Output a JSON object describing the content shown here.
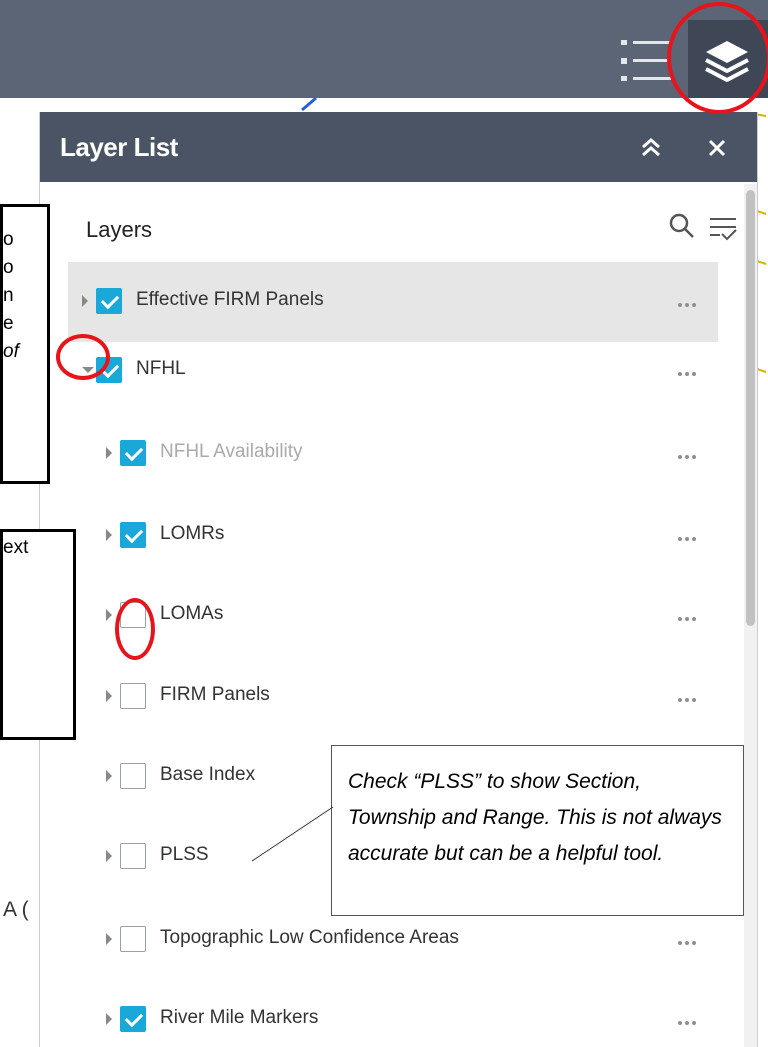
{
  "colors": {
    "topbar": "#5b6575",
    "panel_header": "#4a5465",
    "checkbox_checked": "#19a8d8",
    "annotation_circle": "#e8141b",
    "selected_row": "#e6e6e6"
  },
  "toolbar": {
    "list_icon": "list-icon",
    "layers_icon": "layers-icon"
  },
  "panel": {
    "title": "Layer List",
    "collapse_icon": "double-chevron-up-icon",
    "close_icon": "close-icon",
    "layers_heading": "Layers",
    "search_icon": "search-icon",
    "filter_icon": "filter-icon"
  },
  "layers": [
    {
      "label": "Effective FIRM Panels",
      "checked": true,
      "expanded": false,
      "level": 0,
      "dim": false,
      "selected": true
    },
    {
      "label": "NFHL",
      "checked": true,
      "expanded": true,
      "level": 0,
      "dim": false,
      "selected": false
    },
    {
      "label": "NFHL Availability",
      "checked": true,
      "expanded": false,
      "level": 1,
      "dim": true,
      "selected": false
    },
    {
      "label": "LOMRs",
      "checked": true,
      "expanded": false,
      "level": 1,
      "dim": false,
      "selected": false
    },
    {
      "label": "LOMAs",
      "checked": false,
      "expanded": false,
      "level": 1,
      "dim": false,
      "selected": false
    },
    {
      "label": "FIRM Panels",
      "checked": false,
      "expanded": false,
      "level": 1,
      "dim": false,
      "selected": false
    },
    {
      "label": "Base Index",
      "checked": false,
      "expanded": false,
      "level": 1,
      "dim": false,
      "selected": false
    },
    {
      "label": "PLSS",
      "checked": false,
      "expanded": false,
      "level": 1,
      "dim": false,
      "selected": false
    },
    {
      "label": "Topographic Low Confidence Areas",
      "checked": false,
      "expanded": false,
      "level": 1,
      "dim": false,
      "selected": false
    },
    {
      "label": "River Mile Markers",
      "checked": true,
      "expanded": false,
      "level": 1,
      "dim": false,
      "selected": false
    }
  ],
  "annotations": {
    "box1_lines": [
      "o",
      "o",
      "n",
      "e",
      "of"
    ],
    "box2_lines": [
      "ext"
    ],
    "callout_text": "Check “PLSS” to show Section, Township and Range.  This is not always accurate but can be a helpful tool.",
    "map_label": "A ("
  }
}
